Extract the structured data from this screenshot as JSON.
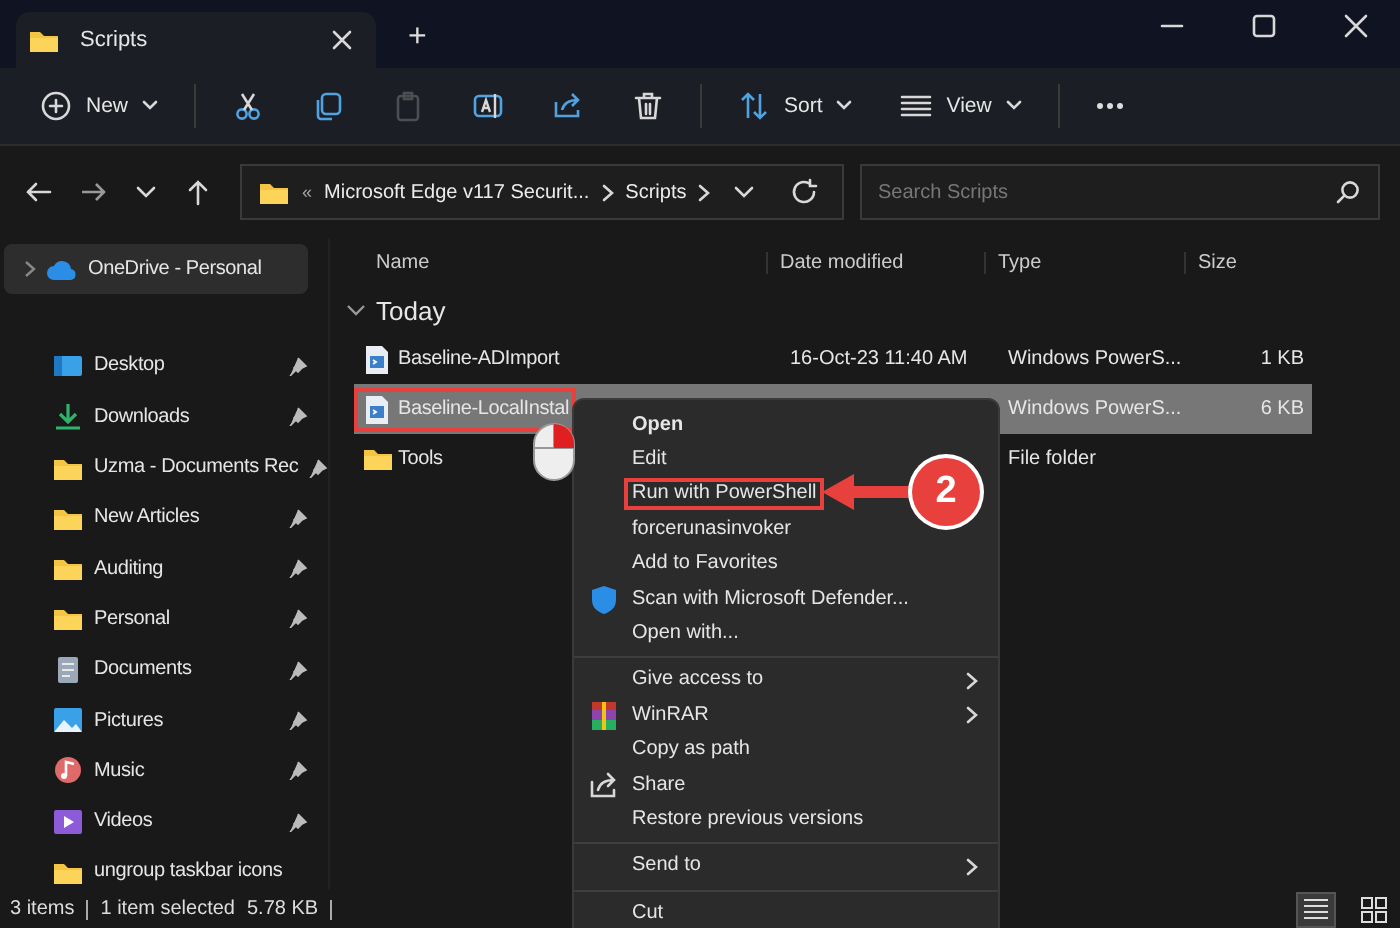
{
  "window": {
    "tab_title": "Scripts",
    "new_tab": "+"
  },
  "toolbar": [
    {
      "kind": "new",
      "label": "New",
      "disabled": false
    },
    {
      "kind": "cut",
      "disabled": false
    },
    {
      "kind": "copy",
      "disabled": false
    },
    {
      "kind": "paste",
      "disabled": true
    },
    {
      "kind": "rename",
      "disabled": false
    },
    {
      "kind": "share",
      "disabled": false
    },
    {
      "kind": "delete",
      "disabled": false
    },
    {
      "kind": "sort",
      "label": "Sort",
      "disabled": false
    },
    {
      "kind": "view",
      "label": "View",
      "disabled": false
    },
    {
      "kind": "more",
      "disabled": false
    }
  ],
  "address": {
    "overflow": "«",
    "crumbs": [
      "Microsoft Edge v117 Securit...",
      "Scripts"
    ],
    "search_placeholder": "Search Scripts"
  },
  "sidebar": {
    "top": {
      "label": "OneDrive - Personal",
      "selected": true
    },
    "items": [
      {
        "kind": "desktop",
        "label": "Desktop",
        "pinned": true
      },
      {
        "kind": "downloads",
        "label": "Downloads",
        "pinned": true
      },
      {
        "kind": "folder",
        "label": "Uzma - Documents Rec",
        "pinned": true
      },
      {
        "kind": "folder",
        "label": "New Articles",
        "pinned": true
      },
      {
        "kind": "folder",
        "label": "Auditing",
        "pinned": true
      },
      {
        "kind": "folder",
        "label": "Personal",
        "pinned": true
      },
      {
        "kind": "documents",
        "label": "Documents",
        "pinned": true
      },
      {
        "kind": "pictures",
        "label": "Pictures",
        "pinned": true
      },
      {
        "kind": "music",
        "label": "Music",
        "pinned": true
      },
      {
        "kind": "videos",
        "label": "Videos",
        "pinned": true
      },
      {
        "kind": "folder",
        "label": "ungroup taskbar icons",
        "pinned": false
      }
    ]
  },
  "files": {
    "columns": [
      "Name",
      "Date modified",
      "Type",
      "Size"
    ],
    "group": "Today",
    "rows": [
      {
        "kind": "script",
        "name": "Baseline-ADImport",
        "date": "16-Oct-23 11:40 AM",
        "type": "Windows PowerS...",
        "size": "1 KB",
        "selected": false,
        "annotated": false
      },
      {
        "kind": "script",
        "name": "Baseline-LocalInstal",
        "type": "Windows PowerS...",
        "size": "6 KB",
        "selected": true,
        "annotated": true
      },
      {
        "kind": "folder",
        "name": "Tools",
        "type": "File folder",
        "selected": false,
        "annotated": false
      }
    ]
  },
  "context_menu": [
    {
      "kind": "item",
      "label": "Open",
      "bold": true,
      "submenu": false,
      "annotated": false
    },
    {
      "kind": "item",
      "label": "Edit",
      "bold": false,
      "submenu": false,
      "annotated": false
    },
    {
      "kind": "item",
      "label": "Run with PowerShell",
      "bold": false,
      "submenu": false,
      "annotated": true
    },
    {
      "kind": "item",
      "label": "forcerunasinvoker",
      "bold": false,
      "submenu": false,
      "annotated": false
    },
    {
      "kind": "item",
      "label": "Add to Favorites",
      "bold": false,
      "submenu": false,
      "annotated": false
    },
    {
      "kind": "scan",
      "label": "Scan with Microsoft Defender...",
      "bold": false,
      "submenu": false,
      "annotated": false
    },
    {
      "kind": "item",
      "label": "Open with...",
      "bold": false,
      "submenu": false,
      "annotated": false
    },
    {
      "kind": "separator"
    },
    {
      "kind": "item",
      "label": "Give access to",
      "bold": false,
      "submenu": true,
      "annotated": false
    },
    {
      "kind": "archive",
      "label": "WinRAR",
      "bold": false,
      "submenu": true,
      "annotated": false
    },
    {
      "kind": "item",
      "label": "Copy as path",
      "bold": false,
      "submenu": false,
      "annotated": false
    },
    {
      "kind": "share",
      "label": "Share",
      "bold": false,
      "submenu": false,
      "annotated": false
    },
    {
      "kind": "item",
      "label": "Restore previous versions",
      "bold": false,
      "submenu": false,
      "annotated": false
    },
    {
      "kind": "separator"
    },
    {
      "kind": "item",
      "label": "Send to",
      "bold": false,
      "submenu": true,
      "annotated": false
    },
    {
      "kind": "separator"
    },
    {
      "kind": "item",
      "label": "Cut",
      "bold": false,
      "submenu": false,
      "annotated": false
    }
  ],
  "callout": {
    "step": "2"
  },
  "status_bar": {
    "items": [
      "3 items",
      "1 item selected",
      "5.78 KB"
    ],
    "views": [
      {
        "kind": "details",
        "selected": true
      },
      {
        "kind": "tiles",
        "selected": false
      }
    ]
  }
}
